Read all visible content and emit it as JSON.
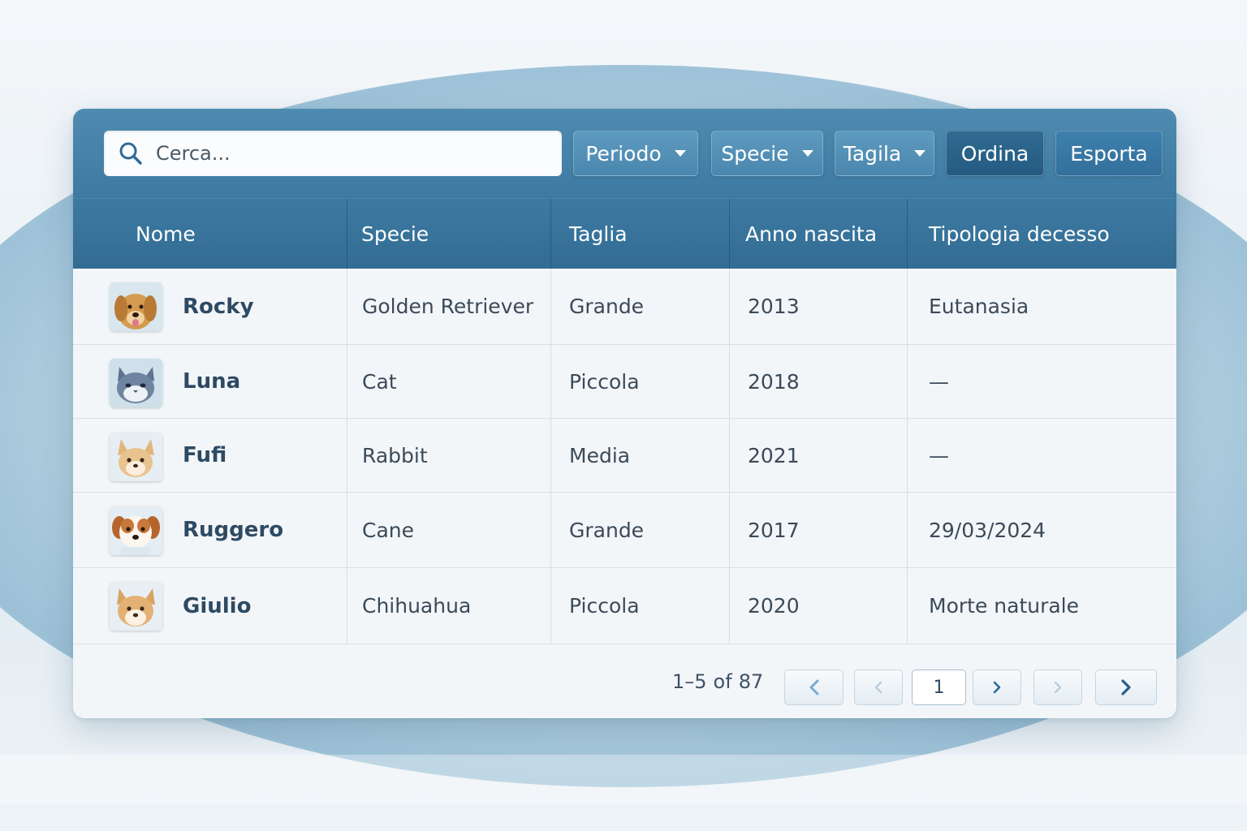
{
  "toolbar": {
    "search_placeholder": "Cerca...",
    "filters": [
      {
        "label": "Periodo"
      },
      {
        "label": "Specie"
      },
      {
        "label": "Tagila"
      }
    ],
    "sort_label": "Ordina",
    "export_label": "Esporta"
  },
  "table": {
    "columns": [
      "Nome",
      "Specie",
      "Taglia",
      "Anno nascita",
      "Tipologia decesso"
    ],
    "rows": [
      {
        "name": "Rocky",
        "species": "Golden Retriever",
        "size": "Grande",
        "birth_year": "2013",
        "death_type": "Eutanasia",
        "avatar": "golden-retriever-avatar"
      },
      {
        "name": "Luna",
        "species": "Cat",
        "size": "Piccola",
        "birth_year": "2018",
        "death_type": "—",
        "avatar": "cat-avatar"
      },
      {
        "name": "Fufi",
        "species": "Rabbit",
        "size": "Media",
        "birth_year": "2021",
        "death_type": "—",
        "avatar": "fox-avatar"
      },
      {
        "name": "Ruggero",
        "species": "Cane",
        "size": "Grande",
        "birth_year": "2017",
        "death_type": "29/03/2024",
        "avatar": "dog-avatar"
      },
      {
        "name": "Giulio",
        "species": "Chihuahua",
        "size": "Piccola",
        "birth_year": "2020",
        "death_type": "Morte naturale",
        "avatar": "corgi-avatar"
      }
    ]
  },
  "pagination": {
    "range_prefix": "1–5",
    "range_of": "of",
    "range_total": "87",
    "current_page": "1"
  },
  "colors": {
    "toolbar": "#4a86ad",
    "header": "#326c93",
    "accent_dark": "#245b81",
    "text_name": "#2e4a63"
  }
}
